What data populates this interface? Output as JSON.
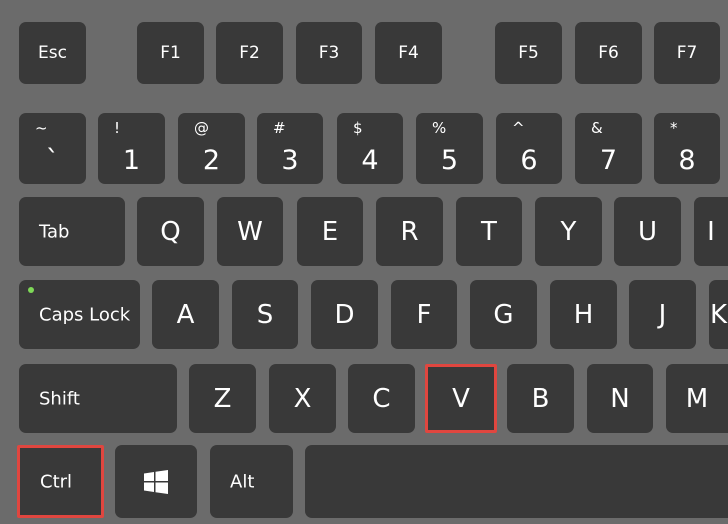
{
  "colors": {
    "background": "#6b6b6b",
    "key": "#393939",
    "highlight": "#e0463f",
    "caps_indicator": "#7ed957"
  },
  "highlighted_keys": [
    "Ctrl",
    "V"
  ],
  "rows": {
    "function": [
      "Esc",
      "F1",
      "F2",
      "F3",
      "F4",
      "F5",
      "F6",
      "F7"
    ],
    "number": [
      {
        "shift": "~",
        "main": "`"
      },
      {
        "shift": "!",
        "main": "1"
      },
      {
        "shift": "@",
        "main": "2"
      },
      {
        "shift": "#",
        "main": "3"
      },
      {
        "shift": "$",
        "main": "4"
      },
      {
        "shift": "%",
        "main": "5"
      },
      {
        "shift": "^",
        "main": "6"
      },
      {
        "shift": "&",
        "main": "7"
      },
      {
        "shift": "*",
        "main": "8"
      }
    ],
    "top": [
      "Tab",
      "Q",
      "W",
      "E",
      "R",
      "T",
      "Y",
      "U",
      "I"
    ],
    "home": [
      "Caps Lock",
      "A",
      "S",
      "D",
      "F",
      "G",
      "H",
      "J",
      "K"
    ],
    "bottom": [
      "Shift",
      "Z",
      "X",
      "C",
      "V",
      "B",
      "N",
      "M"
    ],
    "modifier": [
      "Ctrl",
      "windows-icon",
      "Alt",
      ""
    ]
  }
}
